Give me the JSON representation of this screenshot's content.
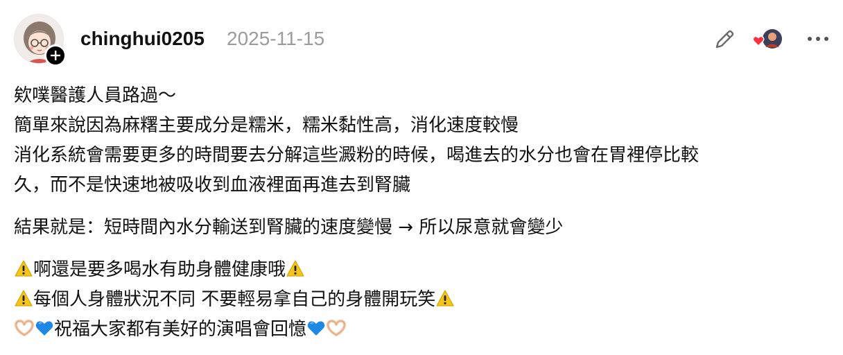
{
  "post": {
    "username": "chinghui0205",
    "timestamp": "2025-11-15",
    "icons": {
      "avatar": "avatar-illustration",
      "follow": "plus-icon",
      "edit": "pencil-icon",
      "reaction": "heart-avatar-reaction",
      "more": "ellipsis-icon"
    },
    "paragraphs": [
      [
        "欸噗醫護人員路過～",
        "簡單來說因為麻糬主要成分是糯米，糯米黏性高，消化速度較慢",
        "消化系統會需要更多的時間要去分解這些澱粉的時候，喝進去的水分也會在胃裡停比較",
        "久，而不是快速地被吸收到血液裡面再進去到腎臟"
      ],
      [
        "結果就是：短時間內水分輸送到腎臟的速度變慢 → 所以尿意就會變少"
      ]
    ],
    "emoji_lines": [
      {
        "text": "啊還是要多喝水有助身體健康哦",
        "lead": "warning",
        "trail": "warning"
      },
      {
        "text": "每個人身體狀況不同 不要輕易拿自己的身體開玩笑",
        "lead": "warning",
        "trail": "warning"
      },
      {
        "text": "祝福大家都有美好的演唱會回憶",
        "lead": "heart-hands+blue-heart",
        "trail": "blue-heart+heart-hands"
      }
    ],
    "colors": {
      "text": "#111111",
      "muted": "#9b9b9b",
      "heart": "#ff3040",
      "warning": "#f5c518",
      "blue_heart": "#1e88e5"
    }
  }
}
